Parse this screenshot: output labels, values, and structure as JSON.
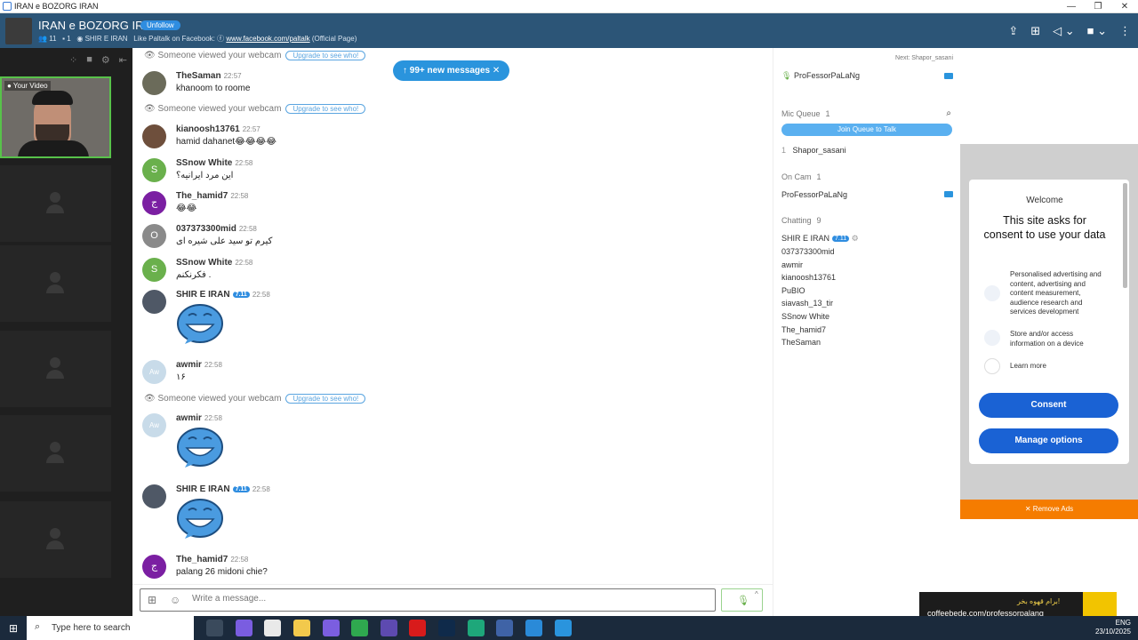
{
  "window": {
    "title": "IRAN e BOZORG IRAN"
  },
  "header": {
    "room_title": "IRAN e BOZORG IRAN",
    "unfollow_label": "Unfollow",
    "users_count": "11",
    "cams_count": "1",
    "owner": "SHIR E IRAN",
    "like_text": "Like Paltalk on Facebook:",
    "fb_link": "www.facebook.com/paltalk",
    "fb_suffix": "(Official Page)"
  },
  "your_video_label": "Your Video",
  "new_messages_label": "99+ new messages",
  "viewed_text": "Someone viewed your webcam",
  "upgrade_label": "Upgrade to see who!",
  "messages": [
    {
      "name": "TheSaman",
      "time": "22:57",
      "text": "khanoom to roome"
    },
    {
      "name": "kianoosh13761",
      "time": "22:57",
      "text": "hamid dahanet😂😂😂😂"
    },
    {
      "name": "SSnow White",
      "time": "22:58",
      "text": "این مرد ایرانیه؟",
      "initial": "S"
    },
    {
      "name": "The_hamid7",
      "time": "22:58",
      "text": "😂😂",
      "initial": "ج"
    },
    {
      "name": "037373300mid",
      "time": "22:58",
      "text": "کیرم تو سید علی شیره ای",
      "initial": "O"
    },
    {
      "name": "SSnow White",
      "time": "22:58",
      "text": "فکرنکنم .",
      "initial": "S"
    },
    {
      "name": "SHIR E IRAN",
      "time": "22:58",
      "badge": "7.11"
    },
    {
      "name": "awmir",
      "time": "22:58",
      "text": "۱۶",
      "initial": "Aw"
    },
    {
      "name": "awmir",
      "time": "22:58",
      "initial": "Aw"
    },
    {
      "name": "SHIR E IRAN",
      "time": "22:58",
      "badge": "7.11"
    },
    {
      "name": "The_hamid7",
      "time": "22:58",
      "text": "palang 26 midoni chie?",
      "initial": "ج"
    }
  ],
  "input": {
    "placeholder": "Write a message..."
  },
  "right_panel": {
    "next_label": "Next: Shapor_sasani",
    "speaker": "ProFessorPaLaNg",
    "mic_queue_label": "Mic Queue",
    "mic_queue_count": "1",
    "join_queue_label": "Join Queue to Talk",
    "queue_user": "Shapor_sasani",
    "queue_index": "1",
    "on_cam_label": "On Cam",
    "on_cam_count": "1",
    "on_cam_user": "ProFessorPaLaNg",
    "chatting_label": "Chatting",
    "chatting_count": "9",
    "chatting_users": [
      "SHIR E IRAN",
      "037373300mid",
      "awmir",
      "kianoosh13761",
      "PuBIO",
      "siavash_13_tir",
      "SSnow White",
      "The_hamid7",
      "TheSaman"
    ],
    "owner_badge": "7.11"
  },
  "consent": {
    "welcome": "Welcome",
    "question": "This site asks for consent to use your data",
    "item1": "Personalised advertising and content, advertising and content measurement, audience research and services development",
    "item2": "Store and/or access information on a device",
    "learn_more": "Learn more",
    "consent_btn": "Consent",
    "manage_btn": "Manage options"
  },
  "remove_ads_label": "✕ Remove Ads",
  "promo": {
    "line1": "برام قهوه بخر!",
    "line2": "coffeebede.com/professorpalang"
  },
  "taskbar": {
    "search_placeholder": "Type here to search",
    "lang": "ENG",
    "date": "23/10/2025"
  },
  "colors": {
    "header": "#2c5577",
    "accent": "#2a94dd",
    "ad_orange": "#f57c00",
    "consent_blue": "#1a62d4"
  }
}
